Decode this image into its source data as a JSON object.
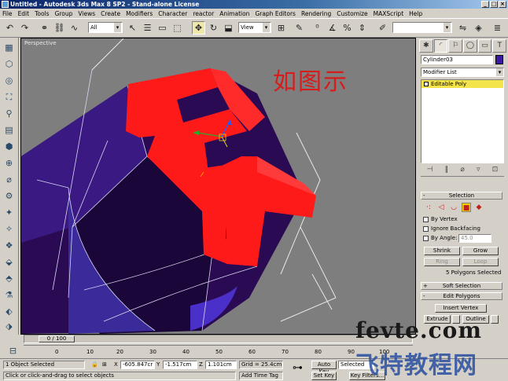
{
  "titlebar": {
    "title": "Untitled - Autodesk 3ds Max 8 SP2 - Stand-alone License",
    "buttons": [
      "_",
      "□",
      "×"
    ]
  },
  "menu": [
    "File",
    "Edit",
    "Tools",
    "Group",
    "Views",
    "Create",
    "Modifiers",
    "Character",
    "reactor",
    "Animation",
    "Graph Editors",
    "Rendering",
    "Customize",
    "MAXScript",
    "Help"
  ],
  "toolbar": {
    "selection_filter": "All",
    "reference_coord": "View"
  },
  "viewport": {
    "label": "Perspective",
    "annotation": "如图示"
  },
  "command_panel": {
    "tabs": [
      "create-icon",
      "modify-icon",
      "hierarchy-icon",
      "motion-icon",
      "display-icon",
      "utilities-icon"
    ],
    "object_name": "Cylinder03",
    "object_color": "#3a1aa0",
    "modifier_list": "Modifier List",
    "stack": [
      {
        "label": "Editable Poly"
      }
    ],
    "selection": {
      "title": "Selection",
      "by_vertex": "By Vertex",
      "ignore_backfacing": "Ignore Backfacing",
      "by_angle": "By Angle:",
      "angle_value": "45.0",
      "shrink": "Shrink",
      "grow": "Grow",
      "ring": "Ring",
      "loop": "Loop",
      "status": "5 Polygons Selected"
    },
    "soft_selection": {
      "title": "Soft Selection"
    },
    "edit_polygons": {
      "title": "Edit Polygons",
      "insert_vertex": "Insert Vertex",
      "extrude": "Extrude",
      "outline": "Outline"
    }
  },
  "timeline": {
    "frame": "0 / 100",
    "ticks": [
      "0",
      "10",
      "20",
      "30",
      "40",
      "50",
      "60",
      "70",
      "80",
      "90",
      "100"
    ]
  },
  "status": {
    "selection": "1 Object Selected",
    "prompt": "Click or click-and-drag to select objects",
    "x_label": "X",
    "x": "-605.847cr",
    "y_label": "Y",
    "y": "-1.517cm",
    "z_label": "Z",
    "z": "1.101cm",
    "grid": "Grid = 25.4cm",
    "add_time_tag": "Add Time Tag",
    "auto_key": "Auto Key",
    "auto_key_value": "Selected",
    "set_key": "Set Key",
    "key_filters": "Key Filters..."
  },
  "watermark": {
    "line1": "fevte.com",
    "line2": "飞特教程网"
  }
}
